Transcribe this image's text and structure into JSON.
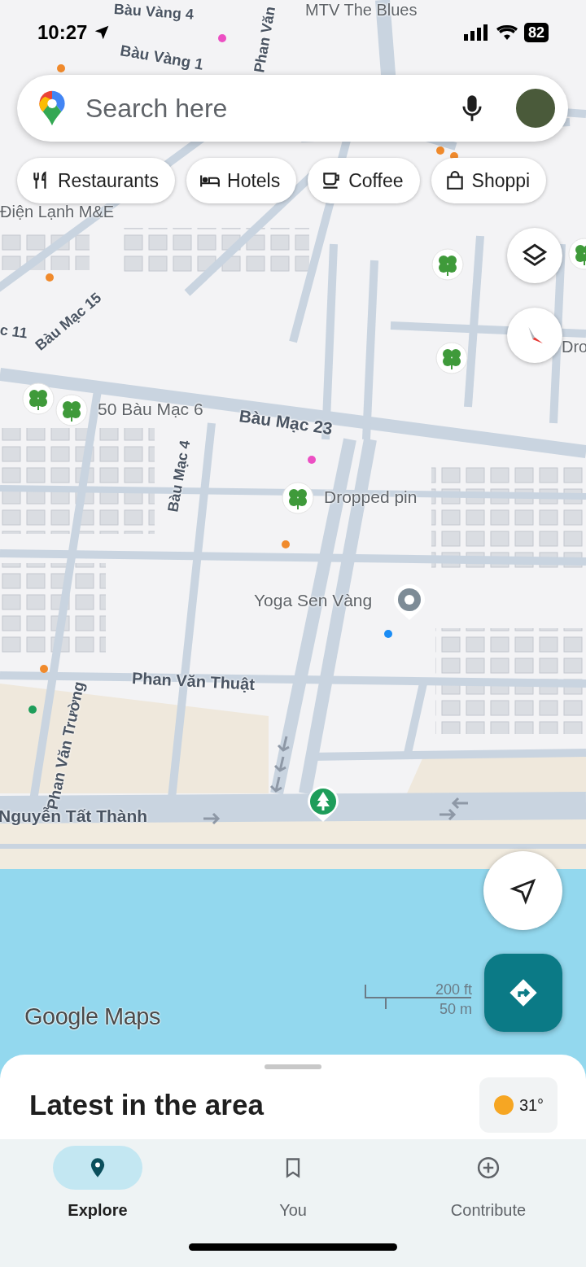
{
  "status_bar": {
    "time": "10:27",
    "battery": "82"
  },
  "search": {
    "placeholder": "Search here"
  },
  "chips": [
    {
      "kind": "restaurants",
      "label": "Restaurants"
    },
    {
      "kind": "hotels",
      "label": "Hotels"
    },
    {
      "kind": "coffee",
      "label": "Coffee"
    },
    {
      "kind": "shopping",
      "label": "Shoppi"
    }
  ],
  "map_labels": [
    {
      "text": "Bàu Vàng 4",
      "kind": "street"
    },
    {
      "text": "MTV The Blues",
      "kind": "place"
    },
    {
      "text": "Bàu Vàng 1",
      "kind": "street"
    },
    {
      "text": "Phan Văn",
      "kind": "street"
    },
    {
      "text": "Điện Lạnh M&E",
      "kind": "place"
    },
    {
      "text": "Bàu Mạc 15",
      "kind": "street"
    },
    {
      "text": "c 11",
      "kind": "street"
    },
    {
      "text": "Dro",
      "kind": "place"
    },
    {
      "text": "50 Bàu Mạc 6",
      "kind": "place"
    },
    {
      "text": "Bàu Mạc 23",
      "kind": "street"
    },
    {
      "text": "Bàu Mạc 4",
      "kind": "street"
    },
    {
      "text": "Dropped pin",
      "kind": "place"
    },
    {
      "text": "Yoga Sen Vàng",
      "kind": "place"
    },
    {
      "text": "Phan Văn Thuật",
      "kind": "street"
    },
    {
      "text": "Phan Văn Trường",
      "kind": "street"
    },
    {
      "text": "Nguyễn Tất Thành",
      "kind": "street"
    }
  ],
  "scale": {
    "imperial": "200 ft",
    "metric": "50 m"
  },
  "logo": "Google Maps",
  "sheet": {
    "title": "Latest in the area",
    "temperature": "31°"
  },
  "nav": [
    {
      "kind": "explore",
      "label": "Explore",
      "selected": true
    },
    {
      "kind": "you",
      "label": "You",
      "selected": false
    },
    {
      "kind": "contribute",
      "label": "Contribute",
      "selected": false
    }
  ]
}
